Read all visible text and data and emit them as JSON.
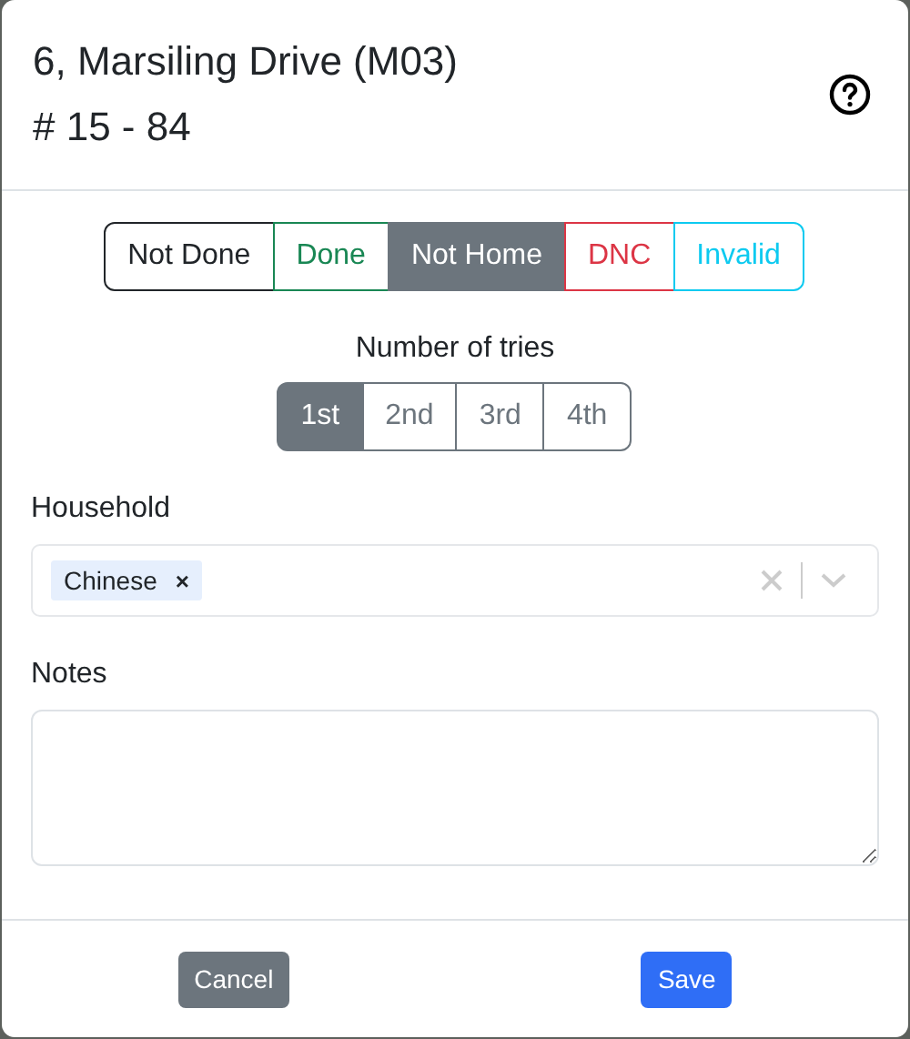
{
  "header": {
    "title": "6, Marsiling Drive (M03)",
    "subtitle": "# 15 - 84"
  },
  "statuses": [
    {
      "label": "Not Done",
      "color": "#212529",
      "selected": false
    },
    {
      "label": "Done",
      "color": "#198754",
      "selected": false
    },
    {
      "label": "Not Home",
      "color": "#6c757d",
      "selected": true
    },
    {
      "label": "DNC",
      "color": "#dc3545",
      "selected": false
    },
    {
      "label": "Invalid",
      "color": "#0dcaf0",
      "selected": false
    }
  ],
  "tries": {
    "label": "Number of tries",
    "options": [
      {
        "label": "1st",
        "selected": true
      },
      {
        "label": "2nd",
        "selected": false
      },
      {
        "label": "3rd",
        "selected": false
      },
      {
        "label": "4th",
        "selected": false
      }
    ]
  },
  "household": {
    "label": "Household",
    "tags": [
      "Chinese"
    ],
    "tag_remove": "×"
  },
  "notes": {
    "label": "Notes"
  },
  "buttons": [
    {
      "label": "Cancel",
      "kind": "secondary"
    },
    {
      "label": "Save",
      "kind": "primary"
    }
  ]
}
